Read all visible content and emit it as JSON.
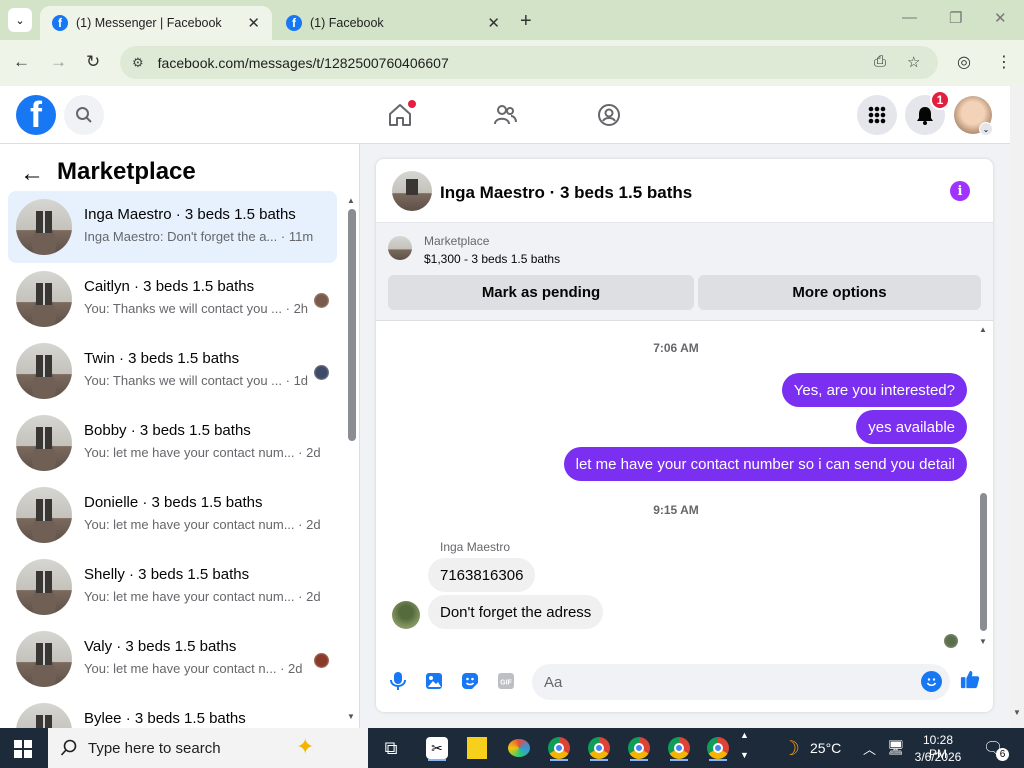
{
  "browser": {
    "tabs": [
      {
        "title": "(1) Messenger | Facebook",
        "active": true
      },
      {
        "title": "(1) Facebook",
        "active": false
      }
    ],
    "url": "facebook.com/messages/t/1282500760406607"
  },
  "fb_header": {
    "notification_count": "1",
    "icons": [
      "facebook-logo",
      "search-icon",
      "home-icon",
      "friends-icon",
      "groups-icon",
      "menu-grid-icon",
      "bell-icon",
      "profile-avatar"
    ]
  },
  "sidebar": {
    "title": "Marketplace",
    "conversations": [
      {
        "title": "Inga Maestro · 3 beds 1.5 baths",
        "preview": "Inga Maestro: Don't forget the a...",
        "time": "· 11m",
        "active": true,
        "seen_color": ""
      },
      {
        "title": "Caitlyn · 3 beds 1.5 baths",
        "preview": "You: Thanks we will contact you ...",
        "time": "· 2h",
        "active": false,
        "seen_color": "#7a5a4a"
      },
      {
        "title": "Twin · 3 beds 1.5 baths",
        "preview": "You: Thanks we will contact you ...",
        "time": "· 1d",
        "active": false,
        "seen_color": "#3d4a6a"
      },
      {
        "title": "Bobby · 3 beds 1.5 baths",
        "preview": "You: let me have your contact num...",
        "time": "· 2d",
        "active": false,
        "seen_color": ""
      },
      {
        "title": "Donielle · 3 beds 1.5 baths",
        "preview": "You: let me have your contact num...",
        "time": "· 2d",
        "active": false,
        "seen_color": ""
      },
      {
        "title": "Shelly · 3 beds 1.5 baths",
        "preview": "You: let me have your contact num...",
        "time": "· 2d",
        "active": false,
        "seen_color": ""
      },
      {
        "title": "Valy · 3 beds 1.5 baths",
        "preview": "You: let me have your contact n...",
        "time": "· 2d",
        "active": false,
        "seen_color": "#8a3a2a"
      },
      {
        "title": "Bylee · 3 beds 1.5 baths",
        "preview": "",
        "time": "",
        "active": false,
        "seen_color": ""
      }
    ]
  },
  "chat": {
    "title": "Inga Maestro · 3 beds 1.5 baths",
    "marketplace_label": "Marketplace",
    "listing": "$1,300 - 3 beds 1.5 baths",
    "mark_pending": "Mark as pending",
    "more_options": "More options",
    "timestamps": [
      "7:06 AM",
      "9:15 AM"
    ],
    "outgoing": [
      "Yes, are you interested?",
      "yes available",
      "let me have your contact number so i can send you detail"
    ],
    "sender_name": "Inga Maestro",
    "incoming": [
      "7163816306",
      "Don't forget the adress"
    ],
    "composer_placeholder": "Aa"
  },
  "taskbar": {
    "search_placeholder": "Type here to search",
    "weather": "25°C",
    "time": "10:28 PM",
    "date": "3/6/2026",
    "notification_count": "6"
  }
}
